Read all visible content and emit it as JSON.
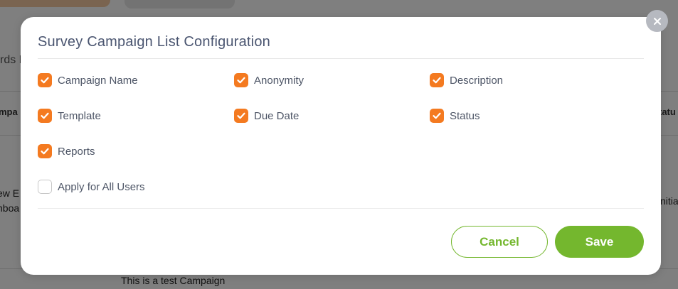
{
  "background": {
    "heading_fragment": "rds R",
    "column_left_fragment": "mpa",
    "column_right_fragment": "tatu",
    "row1_line1_fragment": "ew E",
    "row1_line2_fragment": "nboa",
    "row1_right_fragment": "nitia",
    "row2_text": "This is a test Campaign"
  },
  "modal": {
    "title": "Survey Campaign List Configuration",
    "options": [
      {
        "label": "Campaign Name",
        "checked": true
      },
      {
        "label": "Anonymity",
        "checked": true
      },
      {
        "label": "Description",
        "checked": true
      },
      {
        "label": "Template",
        "checked": true
      },
      {
        "label": "Due Date",
        "checked": true
      },
      {
        "label": "Status",
        "checked": true
      },
      {
        "label": "Reports",
        "checked": true
      }
    ],
    "apply_all": {
      "label": "Apply for All Users",
      "checked": false
    },
    "cancel_label": "Cancel",
    "save_label": "Save",
    "close_icon": "close-icon"
  },
  "colors": {
    "accent_orange": "#f47a20",
    "accent_green": "#74b72e",
    "title_text": "#4a5570"
  }
}
